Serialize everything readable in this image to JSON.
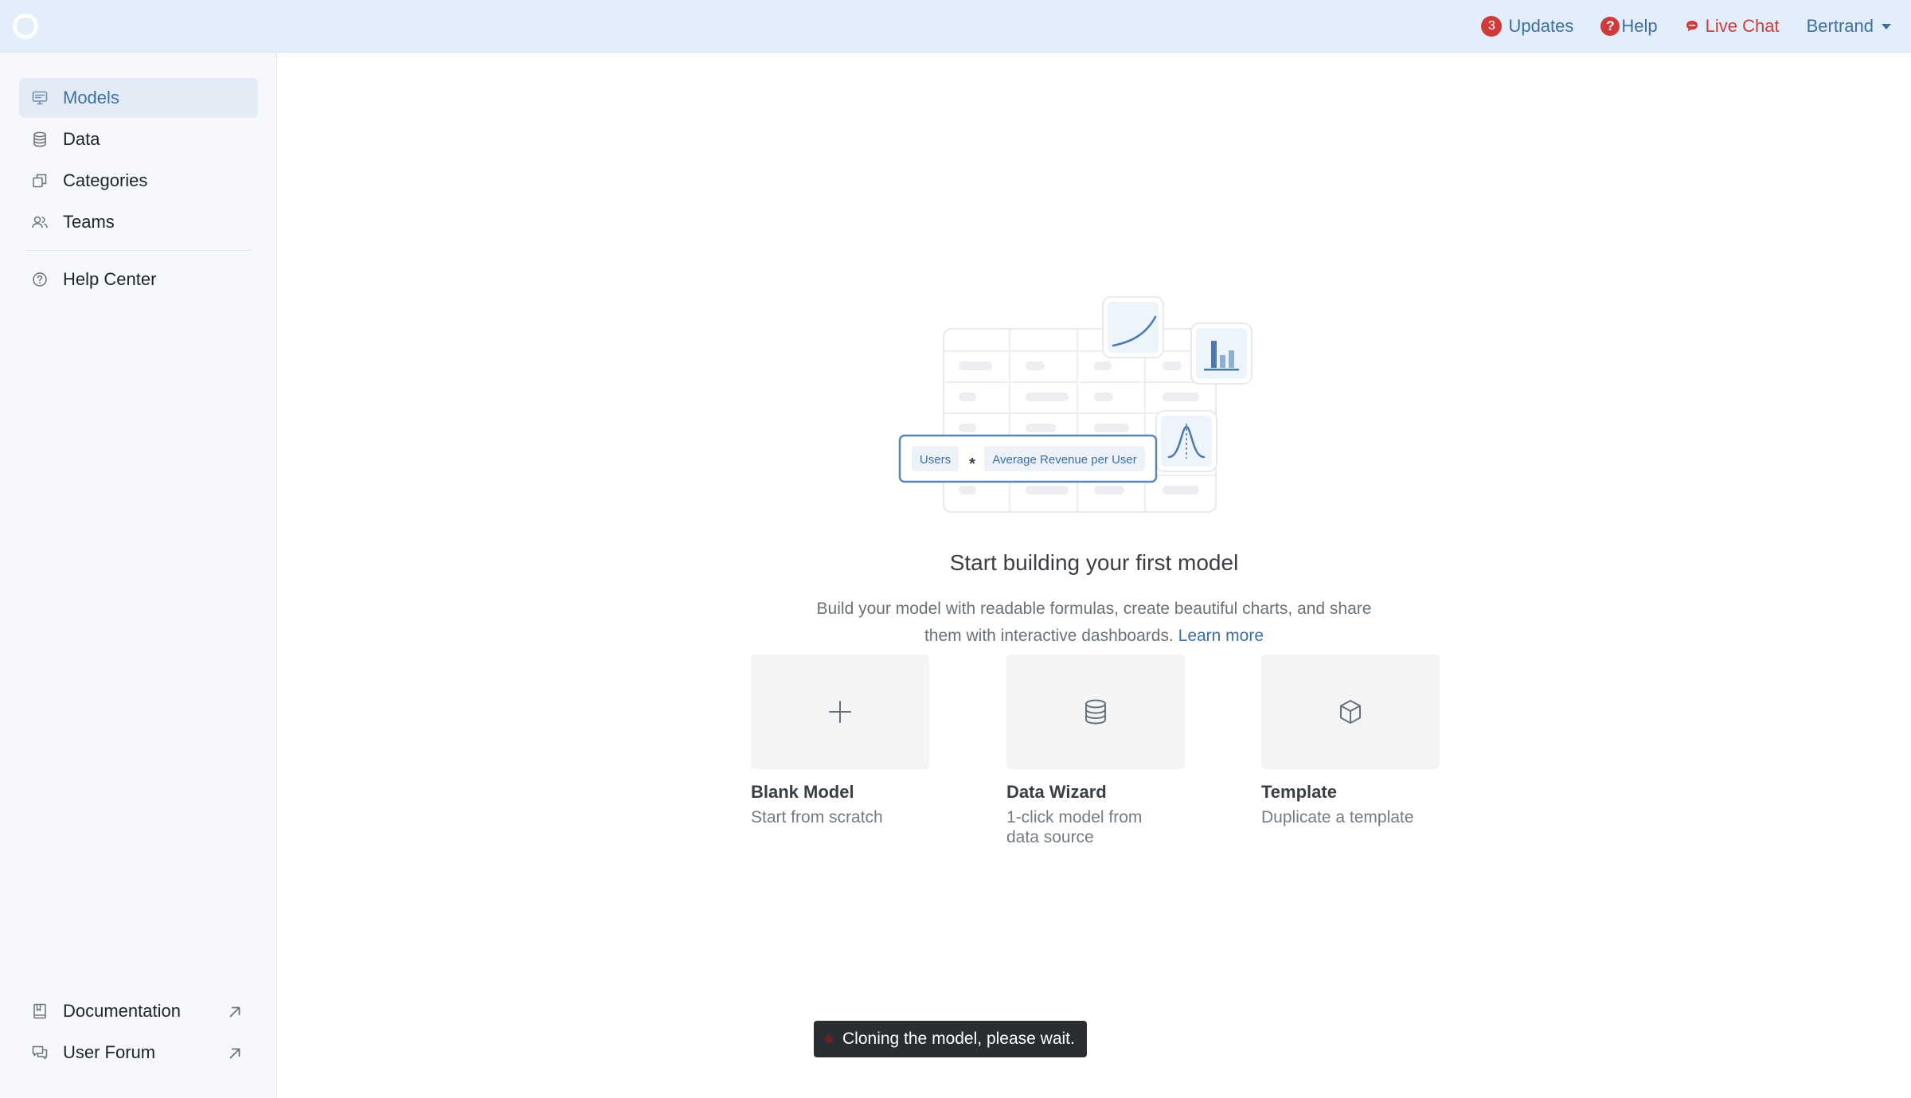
{
  "topbar": {
    "updates_count": "3",
    "updates_label": "Updates",
    "help_icon_glyph": "?",
    "help_label": "Help",
    "live_chat_label": "Live Chat",
    "user_name": "Bertrand"
  },
  "sidebar": {
    "items": [
      {
        "label": "Models",
        "icon": "monitor-icon",
        "active": true
      },
      {
        "label": "Data",
        "icon": "database-icon"
      },
      {
        "label": "Categories",
        "icon": "copy-icon"
      },
      {
        "label": "Teams",
        "icon": "users-icon"
      },
      {
        "label": "Help Center",
        "icon": "question-circle-icon"
      }
    ],
    "footer_items": [
      {
        "label": "Documentation",
        "icon": "book-icon",
        "trailing_icon": "external-link-icon"
      },
      {
        "label": "User Forum",
        "icon": "forum-icon",
        "trailing_icon": "external-link-icon"
      }
    ]
  },
  "illustration": {
    "chip_users": "Users",
    "operator": "*",
    "chip_arpu": "Average Revenue per User"
  },
  "empty_state": {
    "title": "Start building your first model",
    "description_line1": "Build your model with readable formulas, create beautiful charts, and share",
    "description_line2": "them with interactive dashboards.",
    "learn_more": "Learn more"
  },
  "cards": [
    {
      "title": "Blank Model",
      "subtitle_line1": "Start from scratch",
      "icon": "plus-icon"
    },
    {
      "title": "Data Wizard",
      "subtitle_line1": "1-click model from",
      "subtitle_line2": "data source",
      "icon": "database-icon"
    },
    {
      "title": "Template",
      "subtitle_line1": "Duplicate a template",
      "icon": "cube-icon"
    }
  ],
  "toast": {
    "message": "Cloning the model, please wait."
  },
  "colors": {
    "accent": "#3e6fa3",
    "alert": "#cf3b3b",
    "topbar_bg": "#e3eefb",
    "sidebar_bg": "#f6f8fb"
  }
}
